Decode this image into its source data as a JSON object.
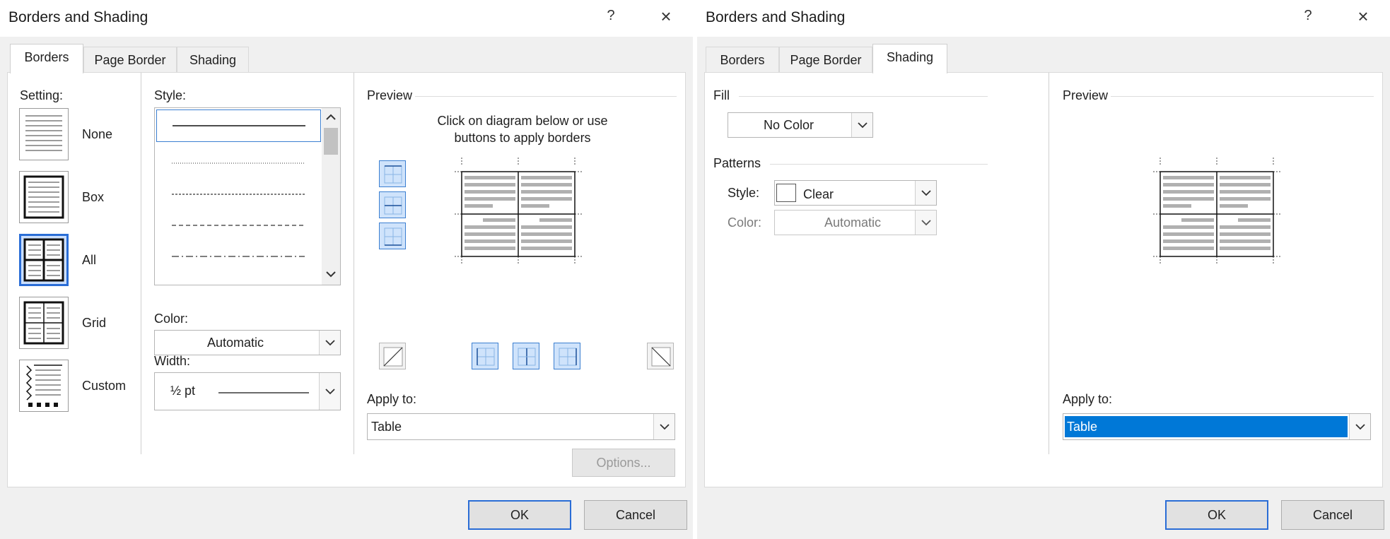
{
  "left_dialog": {
    "title": "Borders and Shading",
    "help": "?",
    "close": "×",
    "tabs": {
      "borders": "Borders",
      "page_border": "Page Border",
      "shading": "Shading"
    },
    "setting": {
      "label": "Setting:",
      "items": {
        "none": "None",
        "box": "Box",
        "all": "All",
        "grid": "Grid",
        "custom": "Custom"
      },
      "selected": "All"
    },
    "style": {
      "label": "Style:"
    },
    "color": {
      "label": "Color:",
      "value": "Automatic"
    },
    "width": {
      "label": "Width:",
      "value": "½ pt"
    },
    "preview": {
      "label": "Preview",
      "instruction_line1": "Click on diagram below or use",
      "instruction_line2": "buttons to apply borders"
    },
    "apply_to": {
      "label": "Apply to:",
      "value": "Table"
    },
    "options_button": "Options...",
    "ok_button": "OK",
    "cancel_button": "Cancel"
  },
  "right_dialog": {
    "title": "Borders and Shading",
    "help": "?",
    "close": "×",
    "tabs": {
      "borders": "Borders",
      "page_border": "Page Border",
      "shading": "Shading"
    },
    "fill": {
      "label": "Fill",
      "value": "No Color"
    },
    "patterns": {
      "label": "Patterns",
      "style_label": "Style:",
      "style_value": "Clear",
      "color_label": "Color:",
      "color_value": "Automatic"
    },
    "preview": {
      "label": "Preview"
    },
    "apply_to": {
      "label": "Apply to:",
      "value": "Table"
    },
    "ok_button": "OK",
    "cancel_button": "Cancel"
  },
  "colors": {
    "dialog_bg": "#f0f0f0",
    "accent": "#2a6dd6",
    "selection": "#0078d7",
    "button_bg": "#e1e1e1"
  }
}
